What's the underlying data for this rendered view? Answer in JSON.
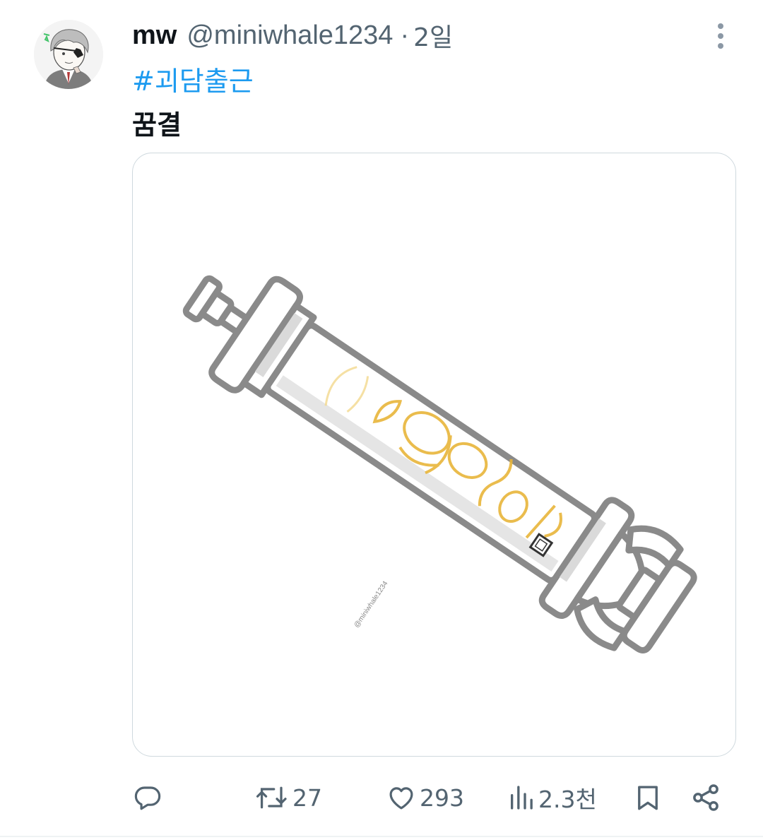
{
  "author": {
    "display_name": "mw",
    "handle": "@miniwhale1234",
    "separator": "·",
    "time": "2일"
  },
  "tweet": {
    "hashtag": "#괴담출근",
    "text": "꿈결"
  },
  "media": {
    "kind": "illustration",
    "signature": "@miniwhale1234"
  },
  "actions": {
    "reply": {
      "icon": "reply-icon",
      "count": ""
    },
    "retweet": {
      "icon": "retweet-icon",
      "count": "27"
    },
    "like": {
      "icon": "heart-icon",
      "count": "293"
    },
    "views": {
      "icon": "views-icon",
      "count": "2.3천"
    },
    "bookmark": {
      "icon": "bookmark-icon"
    },
    "share": {
      "icon": "share-icon"
    }
  },
  "colors": {
    "text": "#0f1419",
    "secondary": "#536471",
    "link": "#1d9bf0",
    "border": "#cfd9de"
  }
}
